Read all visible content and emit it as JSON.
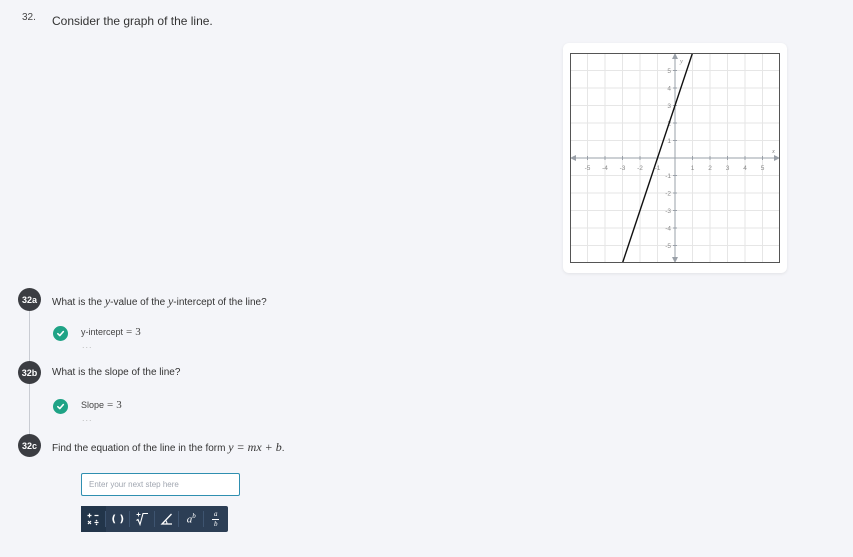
{
  "question": {
    "number": "32.",
    "text": "Consider the graph of the line."
  },
  "graph": {
    "x_ticks": [
      "-5",
      "-4",
      "-3",
      "-2",
      "-1",
      "1",
      "2",
      "3",
      "4",
      "5"
    ],
    "y_ticks": [
      "5",
      "4",
      "3",
      "2",
      "1",
      "-1",
      "-2",
      "-3",
      "-4",
      "-5"
    ],
    "x_axis_label": "x",
    "y_axis_label": "y",
    "line": {
      "slope": 3,
      "intercept": 3
    },
    "range": [
      -6,
      6
    ],
    "colors": {
      "grid": "#e6e6e6",
      "axis": "#9aa0a8",
      "line": "#111111",
      "frame": "#555555"
    }
  },
  "steps": [
    {
      "badge": "32a",
      "prompt_pre": "What is the ",
      "prompt_var1": "y",
      "prompt_mid": "-value of the ",
      "prompt_var2": "y",
      "prompt_post": "-intercept of the line?",
      "answer_label": "y-intercept",
      "answer_eq": "=",
      "answer_value": "3",
      "status": "correct",
      "more": "..."
    },
    {
      "badge": "32b",
      "prompt": "What is the slope of the line?",
      "answer_label": "Slope",
      "answer_eq": "=",
      "answer_value": "3",
      "status": "correct",
      "more": "..."
    },
    {
      "badge": "32c",
      "prompt_pre": "Find the equation of the line in the form ",
      "prompt_formula": "y = mx + b",
      "prompt_post": ".",
      "input_placeholder": "Enter your next step here",
      "input_value": ""
    }
  ],
  "toolbar": {
    "background": "#2c3e55",
    "tools": [
      "plus-minus-times-divide-icon",
      "parentheses-icon",
      "root-icon",
      "angle-icon",
      "exponent-icon",
      "fraction-icon"
    ],
    "glyphs": {
      "parens": "( )",
      "exponent_base": "a",
      "exponent_power": "b",
      "fraction_num": "a",
      "fraction_den": "b"
    }
  },
  "accent": {
    "check": "#1fa386",
    "badge": "#3b3d42",
    "input_border": "#2f8fb0"
  }
}
